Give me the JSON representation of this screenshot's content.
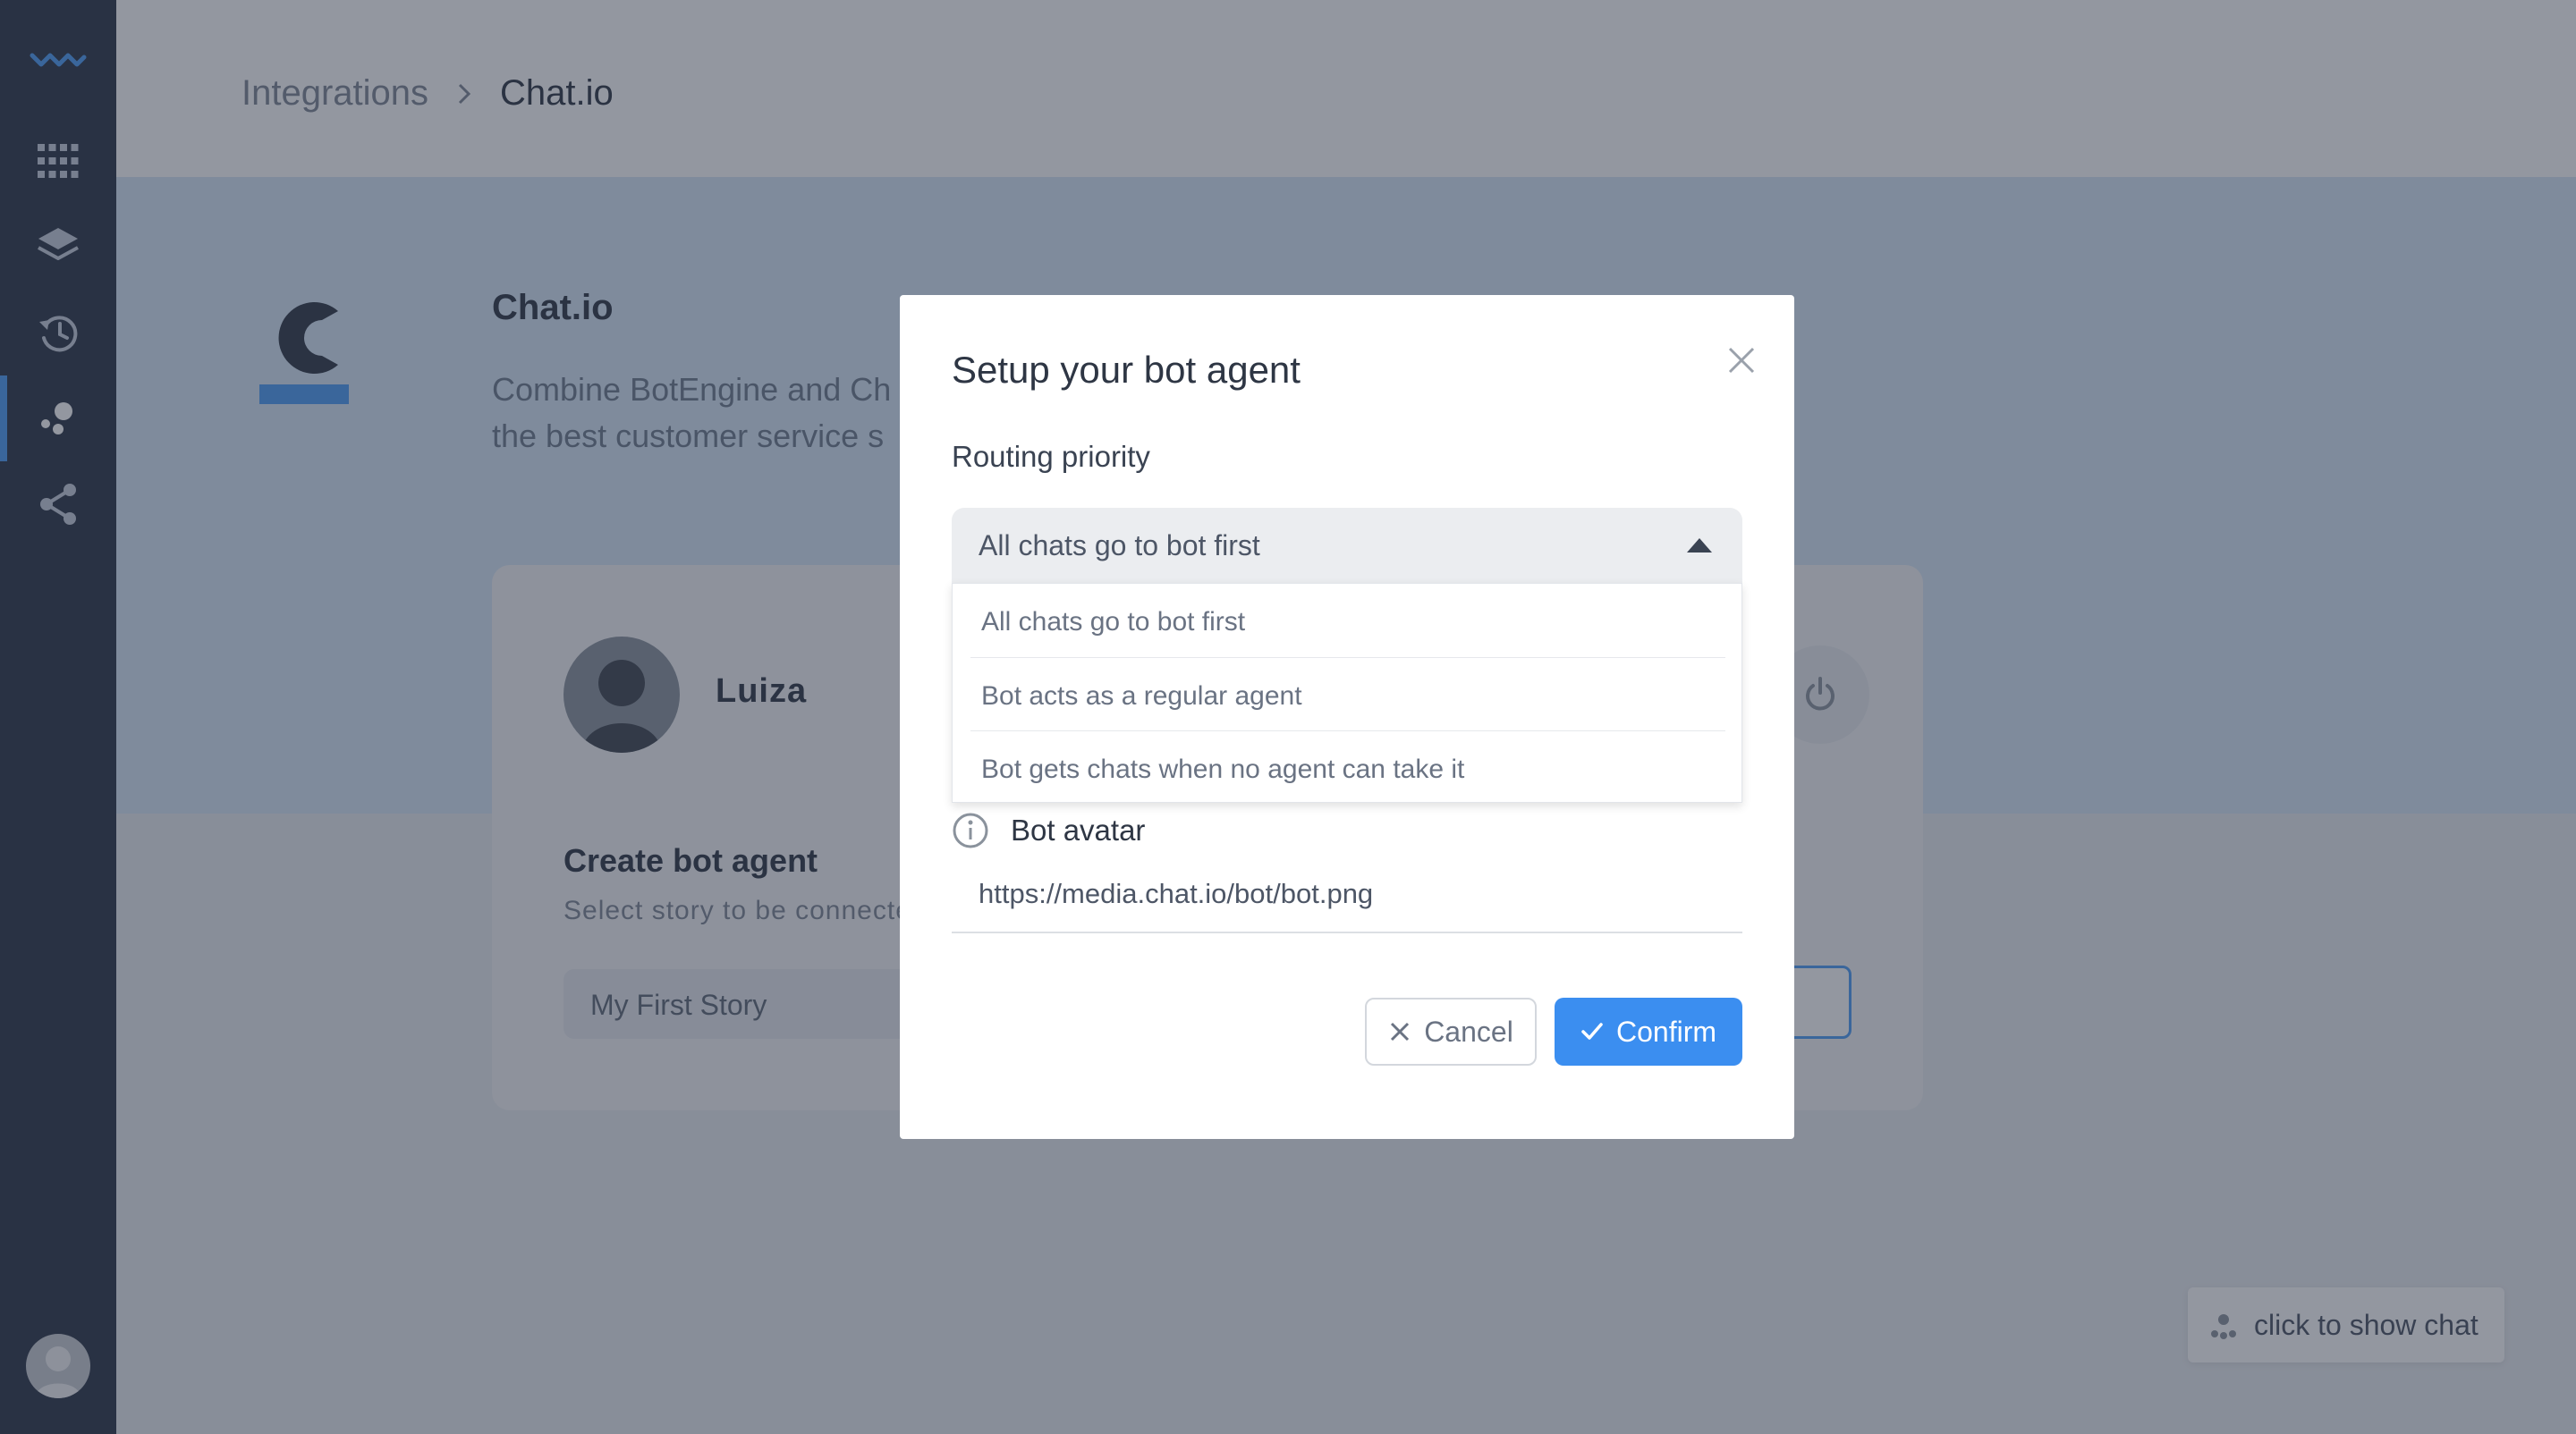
{
  "sidebar": {
    "logo_icon": "wave-logo-icon",
    "items": [
      {
        "icon": "grid-icon"
      },
      {
        "icon": "layers-icon"
      },
      {
        "icon": "history-icon"
      },
      {
        "icon": "integrations-icon",
        "active": true
      },
      {
        "icon": "share-icon"
      }
    ]
  },
  "header": {
    "breadcrumb_root": "Integrations",
    "breadcrumb_current": "Chat.io"
  },
  "banner": {
    "title": "Chat.io",
    "description_line1": "Combine BotEngine and Ch",
    "description_line2": "the best customer service s"
  },
  "card": {
    "name": "Luiza",
    "heading": "Create bot agent",
    "subheading": "Select story to be connecte",
    "story_value": "My First Story"
  },
  "modal": {
    "title": "Setup your bot agent",
    "routing_label": "Routing priority",
    "routing_selected": "All chats go to bot first",
    "routing_options": [
      "All chats go to bot first",
      "Bot acts as a regular agent",
      "Bot gets chats when no agent can take it"
    ],
    "avatar_label": "Bot avatar",
    "avatar_url": "https://media.chat.io/bot/bot.png",
    "cancel_label": "Cancel",
    "confirm_label": "Confirm"
  },
  "chat_widget": {
    "label": "click to show chat"
  },
  "colors": {
    "sidebar_bg": "#2b3446",
    "accent": "#3b8ef0",
    "active_indicator": "#4c9cf5"
  }
}
